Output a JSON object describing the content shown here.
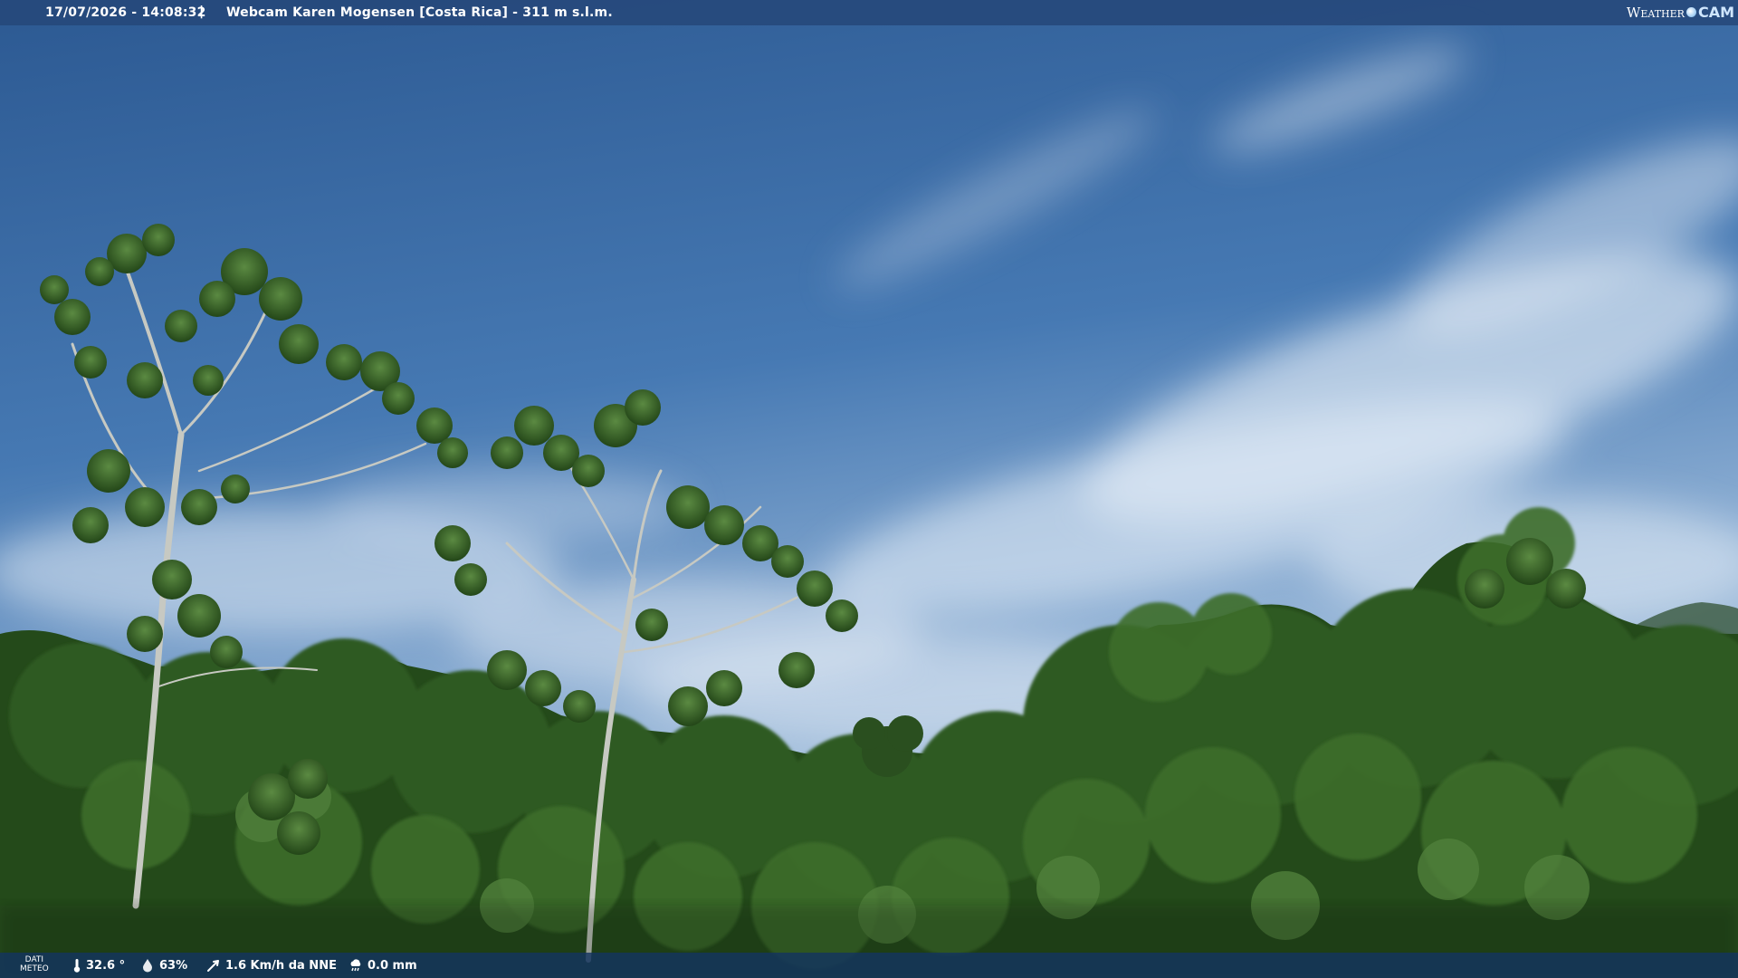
{
  "header": {
    "datetime": "17/07/2026 - 14:08:32",
    "separator": "|",
    "title": "Webcam Karen Mogensen [Costa Rica] - 311 m s.l.m."
  },
  "logo": {
    "word": "Weather",
    "suffix": "CAM"
  },
  "footer": {
    "label_line1": "DATI",
    "label_line2": "METEO",
    "temperature": "32.6 °",
    "humidity": "63%",
    "wind": "1.6 Km/h da NNE",
    "rain": "0.0 mm"
  },
  "colors": {
    "sky_top": "#2f5d96",
    "sky_mid": "#4d7fb8",
    "sky_low": "#a9c4df",
    "foliage_dark": "#1f3d17",
    "foliage": "#2f5b24",
    "foliage_light": "#4f7e3a"
  }
}
